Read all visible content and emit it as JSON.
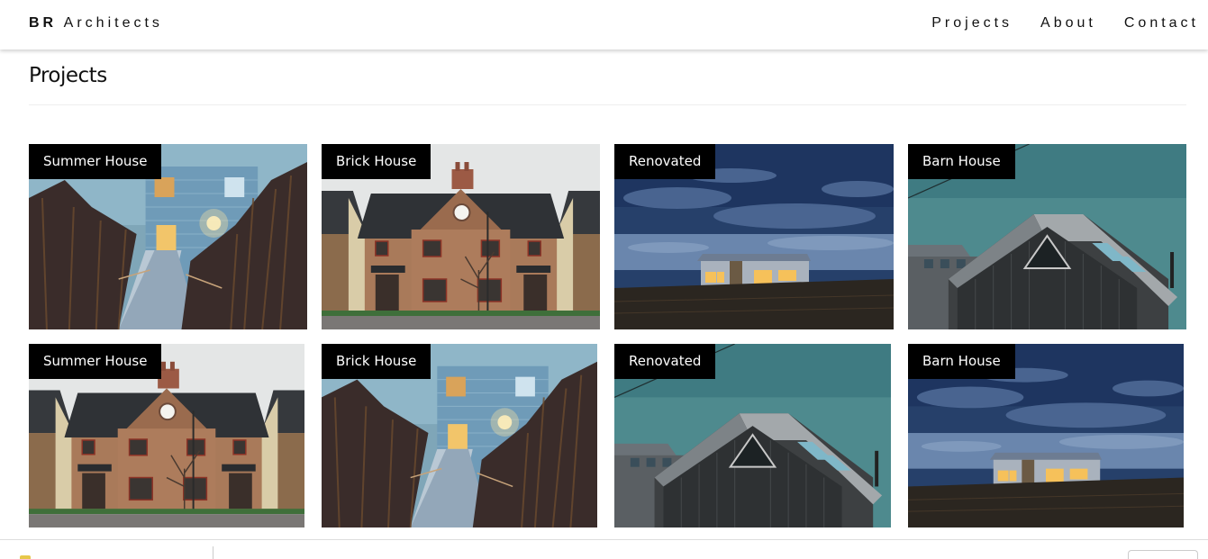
{
  "navbar": {
    "brand_bold": "BR",
    "brand_rest": "Architects",
    "links": [
      {
        "label": "Projects"
      },
      {
        "label": "About"
      },
      {
        "label": "Contact"
      }
    ]
  },
  "page": {
    "title": "Projects"
  },
  "projects": [
    {
      "label": "Summer House",
      "scene": "summer"
    },
    {
      "label": "Brick House",
      "scene": "brick"
    },
    {
      "label": "Renovated",
      "scene": "renovated"
    },
    {
      "label": "Barn House",
      "scene": "barn"
    },
    {
      "label": "Summer House",
      "scene": "brick"
    },
    {
      "label": "Brick House",
      "scene": "summer"
    },
    {
      "label": "Renovated",
      "scene": "barn"
    },
    {
      "label": "Barn House",
      "scene": "renovated"
    }
  ],
  "colors": {
    "tag_bg": "#000000",
    "tag_text": "#ffffff",
    "sky_summer": "#7fa6b8",
    "sky_brick": "#e4e6e6",
    "sky_renovated": "#26406a",
    "sky_barn": "#4e8a8e"
  }
}
